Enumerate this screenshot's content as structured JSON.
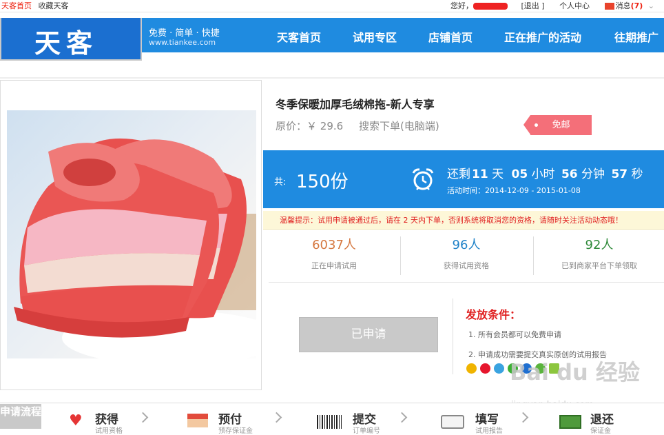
{
  "topbar": {
    "home": "天客首页",
    "fav": "收藏天客",
    "greeting": "您好，",
    "logout": "[退出 ]",
    "user_center": "个人中心",
    "messages": "消息",
    "msg_count": "(7)"
  },
  "header": {
    "logo": "天客",
    "slogan": "免费 · 简单 · 快捷",
    "site": "www.tiankee.com",
    "nav": [
      "天客首页",
      "试用专区",
      "店铺首页",
      "正在推广的活动",
      "往期推广"
    ]
  },
  "product": {
    "title": "冬季保暖加厚毛绒棉拖-新人专享",
    "price_label": "原价：",
    "price": "￥ 29.6",
    "order_type": "搜索下单(电脑端)",
    "free_label": "免邮"
  },
  "offer": {
    "total_label": "共:",
    "total": "150份",
    "remaining": "还剩",
    "days": "11",
    "day_unit": "天",
    "hours": "05",
    "hour_unit": "小时",
    "minutes": "56",
    "minute_unit": "分钟",
    "seconds": "57",
    "second_unit": "秒",
    "activity_label": "活动时间：",
    "activity_time": "2014-12-09 - 2015-01-08"
  },
  "tip": "温馨提示：试用申请被通过后，请在 2 天内下单，否则系统将取消您的资格，请随时关注活动动态哦！",
  "stats": [
    {
      "num": "6037人",
      "caption": "正在申请试用",
      "color": "#d5773f"
    },
    {
      "num": "96人",
      "caption": "获得试用资格",
      "color": "#1f82c8"
    },
    {
      "num": "92人",
      "caption": "已到商家平台下单领取",
      "color": "#2f8a3a"
    }
  ],
  "apply_button": "已申请",
  "conditions": {
    "title": "发放条件：",
    "items": [
      "1. 所有会员都可以免费申请",
      "2. 申请成功需要提交真实原创的试用报告"
    ]
  },
  "flow": {
    "label": "申请流程",
    "steps": [
      {
        "title": "获得",
        "sub": "试用资格"
      },
      {
        "title": "预付",
        "sub": "预存保证金"
      },
      {
        "title": "提交",
        "sub": "订单编号"
      },
      {
        "title": "填写",
        "sub": "试用报告"
      },
      {
        "title": "退还",
        "sub": "保证金"
      }
    ]
  },
  "watermark": {
    "text": "Bai du 经验",
    "url": "jingyan.baidu.com"
  },
  "colors": {
    "brand_blue": "#1f8be0",
    "accent_red": "#e02020",
    "free_badge": "#f46f79"
  }
}
